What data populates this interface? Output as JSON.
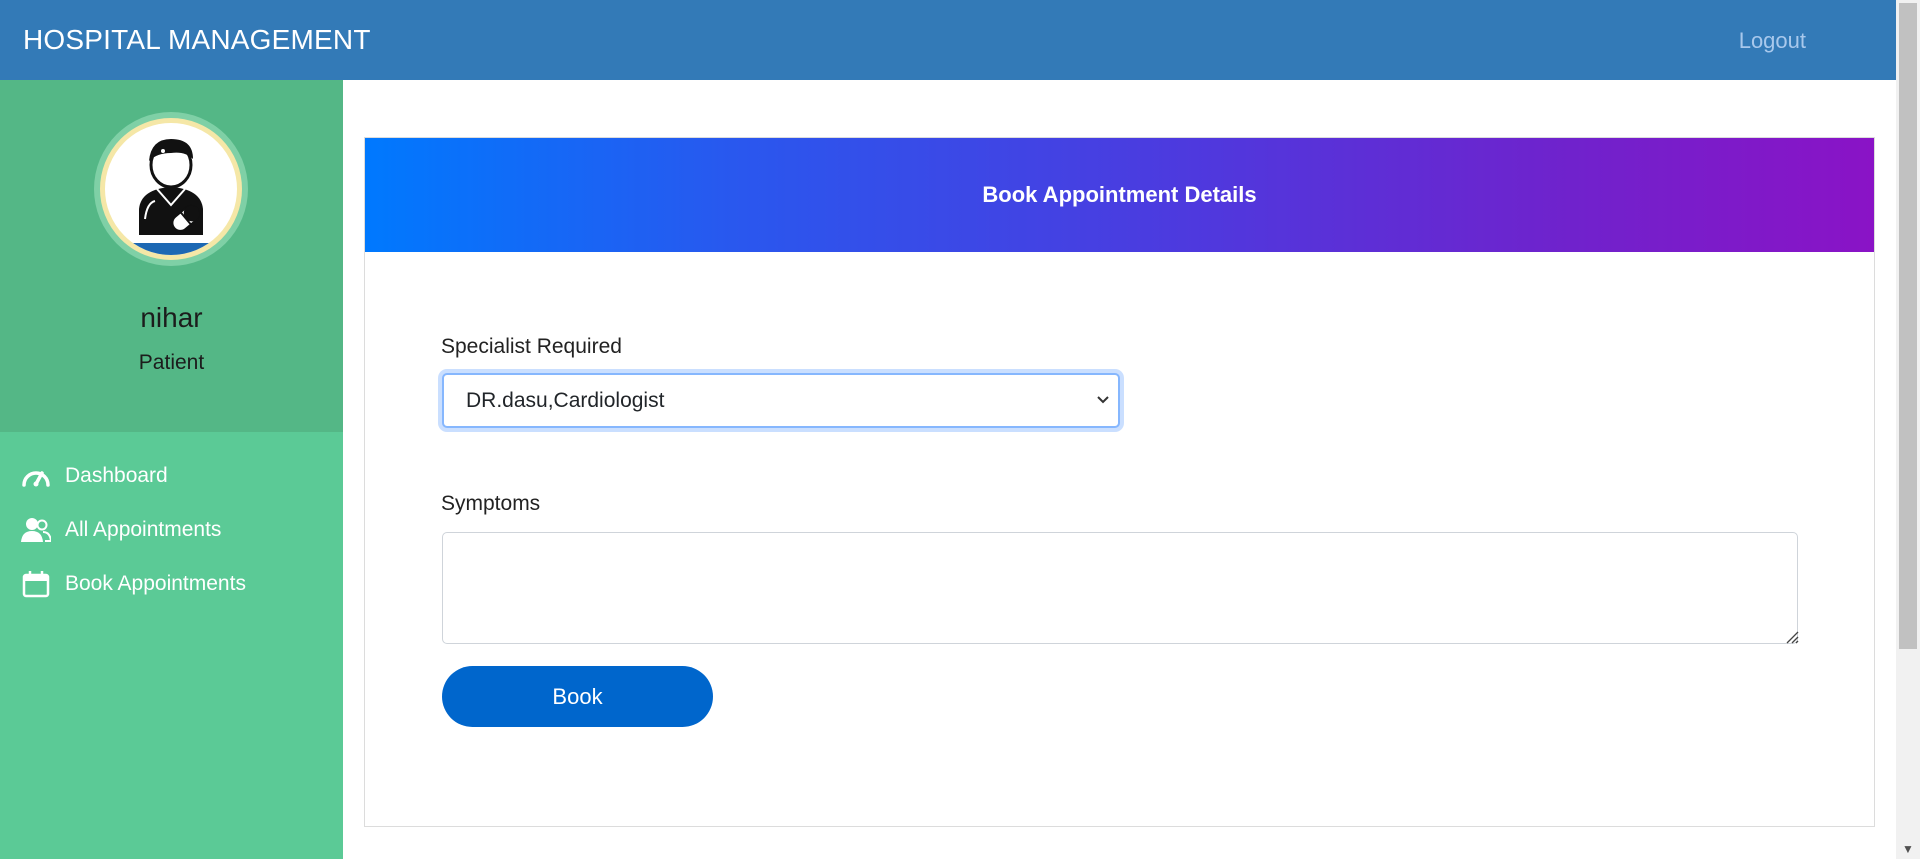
{
  "navbar": {
    "brand": "HOSPITAL MANAGEMENT",
    "logout_label": "Logout"
  },
  "profile": {
    "avatar_icon": "doctor-avatar-icon",
    "name": "nihar",
    "role": "Patient"
  },
  "sidebar": {
    "items": [
      {
        "label": "Dashboard",
        "icon": "speedometer-icon"
      },
      {
        "label": "All Appointments",
        "icon": "users-icon"
      },
      {
        "label": "Book Appointments",
        "icon": "calendar-icon"
      }
    ]
  },
  "form": {
    "header_title": "Book Appointment Details",
    "specialist_label": "Specialist Required",
    "specialist_value": "DR.dasu,Cardiologist",
    "symptoms_label": "Symptoms",
    "symptoms_value": "",
    "book_label": "Book"
  },
  "colors": {
    "navbar": "#337ab7",
    "sidebar": "#5bca96",
    "profile_bg": "#54b786",
    "button": "#0066cc",
    "header_gradient_start": "#0079fe",
    "header_gradient_end": "#8a13c6"
  }
}
